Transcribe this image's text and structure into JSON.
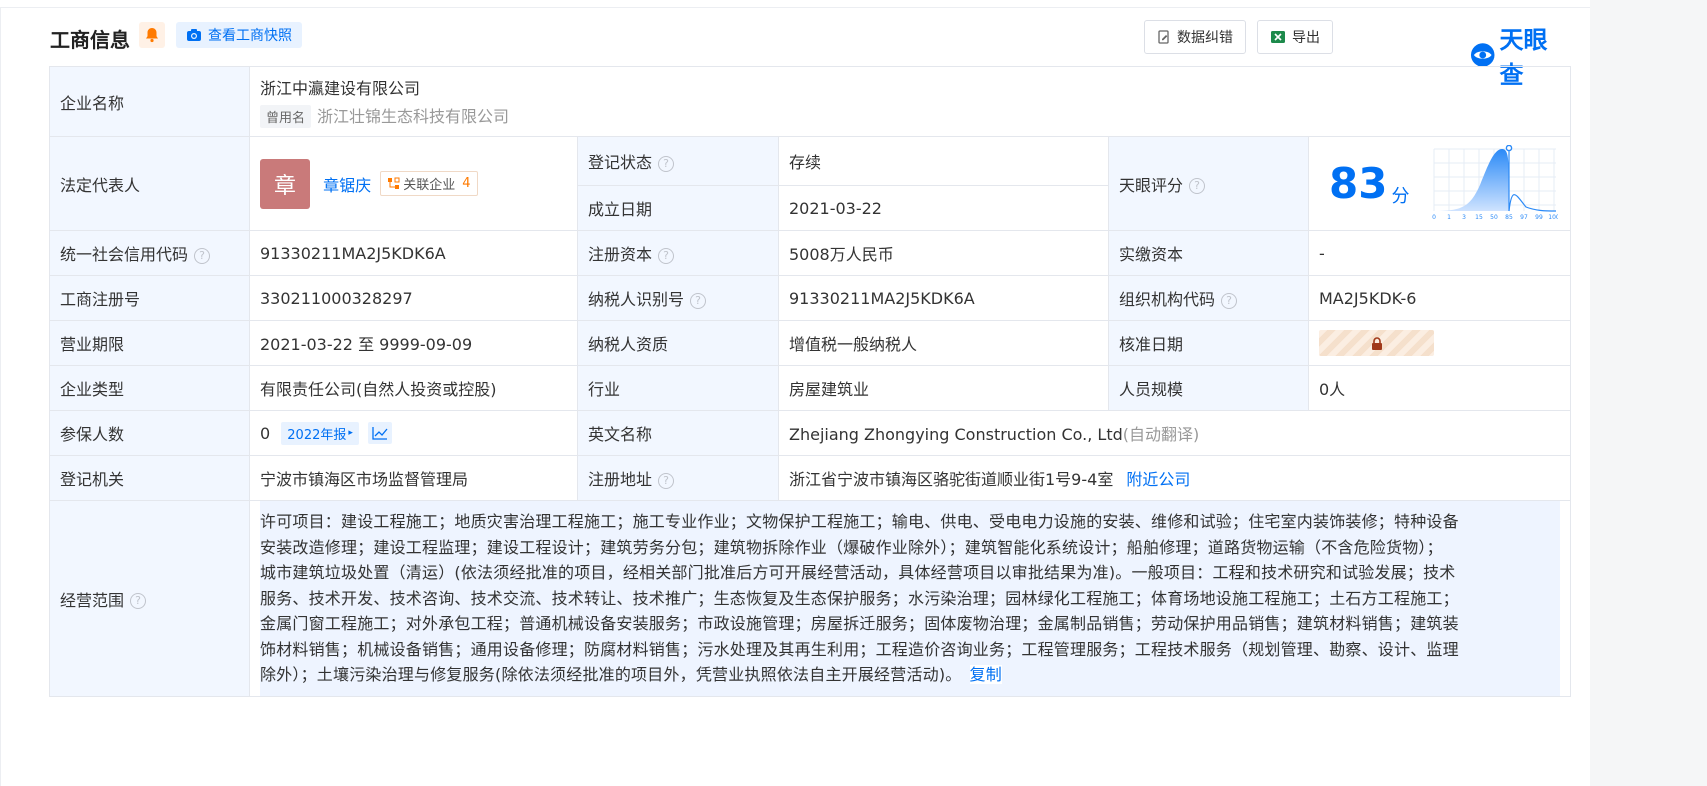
{
  "header": {
    "title": "工商信息",
    "snapshot_label": "查看工商快照",
    "correct_label": "数据纠错",
    "export_label": "导出",
    "logo_text": "天眼查"
  },
  "company": {
    "name_label": "企业名称",
    "name": "浙江中瀛建设有限公司",
    "former_tag": "曾用名",
    "former_name": "浙江壮锦生态科技有限公司"
  },
  "legal": {
    "label": "法定代表人",
    "avatar_char": "章",
    "name": "章锯庆",
    "related_label": "关联企业",
    "related_count": "4"
  },
  "status": {
    "label": "登记状态",
    "value": "存续"
  },
  "established": {
    "label": "成立日期",
    "value": "2021-03-22"
  },
  "rating": {
    "label": "天眼评分",
    "score": "83",
    "unit": "分",
    "ticks": [
      "0",
      "1",
      "3",
      "15",
      "50",
      "85",
      "97",
      "99",
      "100"
    ]
  },
  "rows": {
    "credit_code": {
      "label": "统一社会信用代码",
      "value": "91330211MA2J5KDK6A"
    },
    "reg_capital": {
      "label": "注册资本",
      "value": "5008万人民币"
    },
    "paid_capital": {
      "label": "实缴资本",
      "value": "-"
    },
    "reg_no": {
      "label": "工商注册号",
      "value": "330211000328297"
    },
    "taxpayer_id": {
      "label": "纳税人识别号",
      "value": "91330211MA2J5KDK6A"
    },
    "org_code": {
      "label": "组织机构代码",
      "value": "MA2J5KDK-6"
    },
    "term": {
      "label": "营业期限",
      "value": "2021-03-22 至 9999-09-09"
    },
    "taxpayer_qual": {
      "label": "纳税人资质",
      "value": "增值税一般纳税人"
    },
    "approve_date": {
      "label": "核准日期"
    },
    "type": {
      "label": "企业类型",
      "value": "有限责任公司(自然人投资或控股)"
    },
    "industry": {
      "label": "行业",
      "value": "房屋建筑业"
    },
    "staff": {
      "label": "人员规模",
      "value": "0人"
    },
    "insured": {
      "label": "参保人数",
      "value": "0",
      "report": "2022年报"
    },
    "english": {
      "label": "英文名称",
      "value": "Zhejiang Zhongying Construction Co., Ltd",
      "auto": "(自动翻译)"
    },
    "authority": {
      "label": "登记机关",
      "value": "宁波市镇海区市场监督管理局"
    },
    "address": {
      "label": "注册地址",
      "value": "浙江省宁波市镇海区骆驼街道顺业街1号9-4室",
      "nearby": "附近公司"
    }
  },
  "scope": {
    "label": "经营范围",
    "lines": [
      "许可项目：建设工程施工；地质灾害治理工程施工；施工专业作业；文物保护工程施工；输电、供电、受电电力设施的安装、维修和试验；住宅室内装饰装修；特种设备",
      "安装改造修理；建设工程监理；建设工程设计；建筑劳务分包；建筑物拆除作业（爆破作业除外）；建筑智能化系统设计；船舶修理；道路货物运输（不含危险货物）；",
      "城市建筑垃圾处置（清运）(依法须经批准的项目，经相关部门批准后方可开展经营活动，具体经营项目以审批结果为准)。一般项目：工程和技术研究和试验发展；技术",
      "服务、技术开发、技术咨询、技术交流、技术转让、技术推广；生态恢复及生态保护服务；水污染治理；园林绿化工程施工；体育场地设施工程施工；土石方工程施工；",
      "金属门窗工程施工；对外承包工程；普通机械设备安装服务；市政设施管理；房屋拆迁服务；固体废物治理；金属制品销售；劳动保护用品销售；建筑材料销售；建筑装",
      "饰材料销售；机械设备销售；通用设备修理；防腐材料销售；污水处理及其再生利用；工程造价咨询业务；工程管理服务；工程技术服务（规划管理、勘察、设计、监理",
      "除外）；土壤污染治理与修复服务(除依法须经批准的项目外，凭营业执照依法自主开展经营活动)。"
    ],
    "copy_label": "复制"
  }
}
